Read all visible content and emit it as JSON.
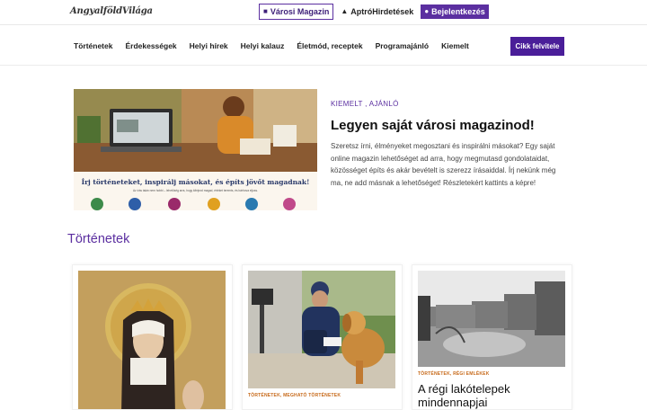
{
  "header": {
    "logo": "AngyalföldVilága",
    "top_links": [
      {
        "label": "Városi Magazin",
        "icon": "book-icon"
      },
      {
        "label": "AptróHirdetések",
        "icon": "megaphone-icon"
      },
      {
        "label": "Bejelentkezés",
        "icon": "lock-icon"
      }
    ]
  },
  "nav": {
    "items": [
      "Történetek",
      "Érdekességek",
      "Helyi hírek",
      "Helyi kalauz",
      "Életmód, receptek",
      "Programajánló",
      "Kiemelt"
    ],
    "cta": "Cikk felvitele"
  },
  "hero": {
    "category": "KIEMELT , AJÁNLÓ",
    "title": "Legyen saját városi magazinod!",
    "text": "Szeretsz írni, élményeket megosztani és inspirálni másokat? Egy saját online magazin lehetőséget ad arra, hogy megmutasd gondolataidat, közösséget építs és akár bevételt is szerezz írásaiddal. Írj nekünk még ma, ne add másnak a lehetőséget! Részletekért kattints a képre!",
    "image_banner": "Írj történeteket, inspirálj másokat, és építs jövőt magadnak!",
    "image_sub": "Az írás talán nem hobbi – lehetőség arra, hogy kifejezd magad, értéket teremts, és bárhova eljuss."
  },
  "section": {
    "title": "Történetek"
  },
  "cards": [
    {
      "category": "",
      "title": ""
    },
    {
      "category": "TÖRTÉNETEK, MEGHATÓ TÖRTÉNETEK",
      "title": ""
    },
    {
      "category": "TÖRTÉNETEK, RÉGI EMLÉKEK",
      "title": "A régi lakótelepek mindennapjai"
    }
  ],
  "colors": {
    "brand": "#5b2fa0",
    "cta": "#4a1e99",
    "category_accent": "#c76a1a"
  }
}
